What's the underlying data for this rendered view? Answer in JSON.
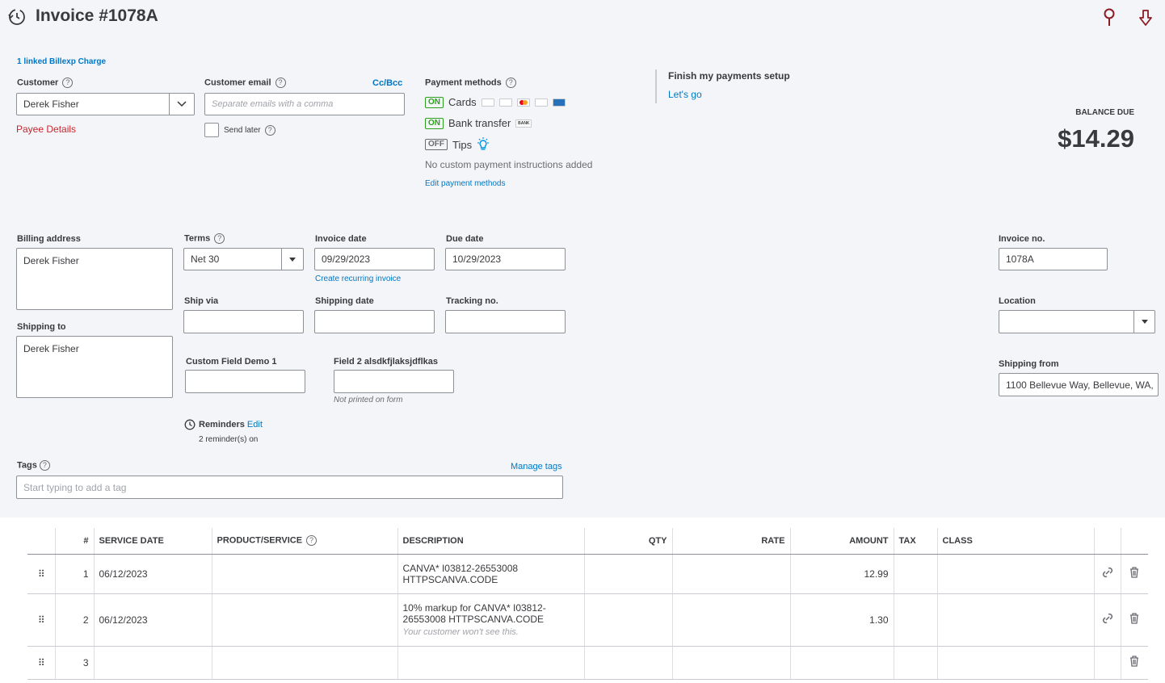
{
  "header": {
    "title": "Invoice #1078A"
  },
  "linked_charge": "1 linked Billexp Charge",
  "customer": {
    "label": "Customer",
    "value": "Derek Fisher",
    "payee_details": "Payee Details"
  },
  "customer_email": {
    "label": "Customer email",
    "placeholder": "Separate emails with a comma",
    "cc_bcc": "Cc/Bcc",
    "send_later": "Send later"
  },
  "payment_methods": {
    "label": "Payment methods",
    "cards": {
      "status": "ON",
      "label": "Cards"
    },
    "bank": {
      "status": "ON",
      "label": "Bank transfer",
      "icon_text": "BANK"
    },
    "tips": {
      "status": "OFF",
      "label": "Tips"
    },
    "no_instructions": "No custom payment instructions added",
    "edit": "Edit payment methods"
  },
  "finish_setup": {
    "title": "Finish my payments setup",
    "link": "Let's go"
  },
  "balance": {
    "label": "BALANCE DUE",
    "amount": "$14.29"
  },
  "billing_address": {
    "label": "Billing address",
    "value": "Derek Fisher"
  },
  "shipping_to": {
    "label": "Shipping to",
    "value": "Derek Fisher"
  },
  "terms": {
    "label": "Terms",
    "value": "Net 30"
  },
  "invoice_date": {
    "label": "Invoice date",
    "value": "09/29/2023",
    "recurring": "Create recurring invoice"
  },
  "due_date": {
    "label": "Due date",
    "value": "10/29/2023"
  },
  "ship_via": {
    "label": "Ship via",
    "value": ""
  },
  "shipping_date": {
    "label": "Shipping date",
    "value": ""
  },
  "tracking_no": {
    "label": "Tracking no.",
    "value": ""
  },
  "custom_field_1": {
    "label": "Custom Field Demo 1",
    "value": ""
  },
  "custom_field_2": {
    "label": "Field 2 alsdkfjlaksjdflkas",
    "value": "",
    "note": "Not printed on form"
  },
  "reminders": {
    "label": "Reminders",
    "edit": "Edit",
    "status": "2 reminder(s) on"
  },
  "invoice_no": {
    "label": "Invoice no.",
    "value": "1078A"
  },
  "location": {
    "label": "Location",
    "value": ""
  },
  "shipping_from": {
    "label": "Shipping from",
    "value": "1100 Bellevue Way, Bellevue, WA,"
  },
  "tags": {
    "label": "Tags",
    "manage": "Manage tags",
    "placeholder": "Start typing to add a tag"
  },
  "table": {
    "headers": {
      "num": "#",
      "service_date": "SERVICE DATE",
      "product": "PRODUCT/SERVICE",
      "description": "DESCRIPTION",
      "qty": "QTY",
      "rate": "RATE",
      "amount": "AMOUNT",
      "tax": "TAX",
      "class": "CLASS"
    },
    "rows": [
      {
        "num": "1",
        "service_date": "06/12/2023",
        "product": "",
        "description": "CANVA* I03812-26553008 HTTPSCANVA.CODE",
        "description_note": "",
        "qty": "",
        "rate": "",
        "amount": "12.99",
        "tax": "",
        "class": ""
      },
      {
        "num": "2",
        "service_date": "06/12/2023",
        "product": "",
        "description": "10% markup for CANVA* I03812-26553008 HTTPSCANVA.CODE",
        "description_note": "Your customer won't see this.",
        "qty": "",
        "rate": "",
        "amount": "1.30",
        "tax": "",
        "class": ""
      },
      {
        "num": "3",
        "service_date": "",
        "product": "",
        "description": "",
        "description_note": "",
        "qty": "",
        "rate": "",
        "amount": "",
        "tax": "",
        "class": ""
      }
    ]
  },
  "colors": {
    "accent": "#0077c5",
    "on_green": "#2ca01c",
    "payee_red": "#c9252c",
    "header_icon_red": "#8c1c24",
    "panel_bg": "#f4f5f8"
  }
}
